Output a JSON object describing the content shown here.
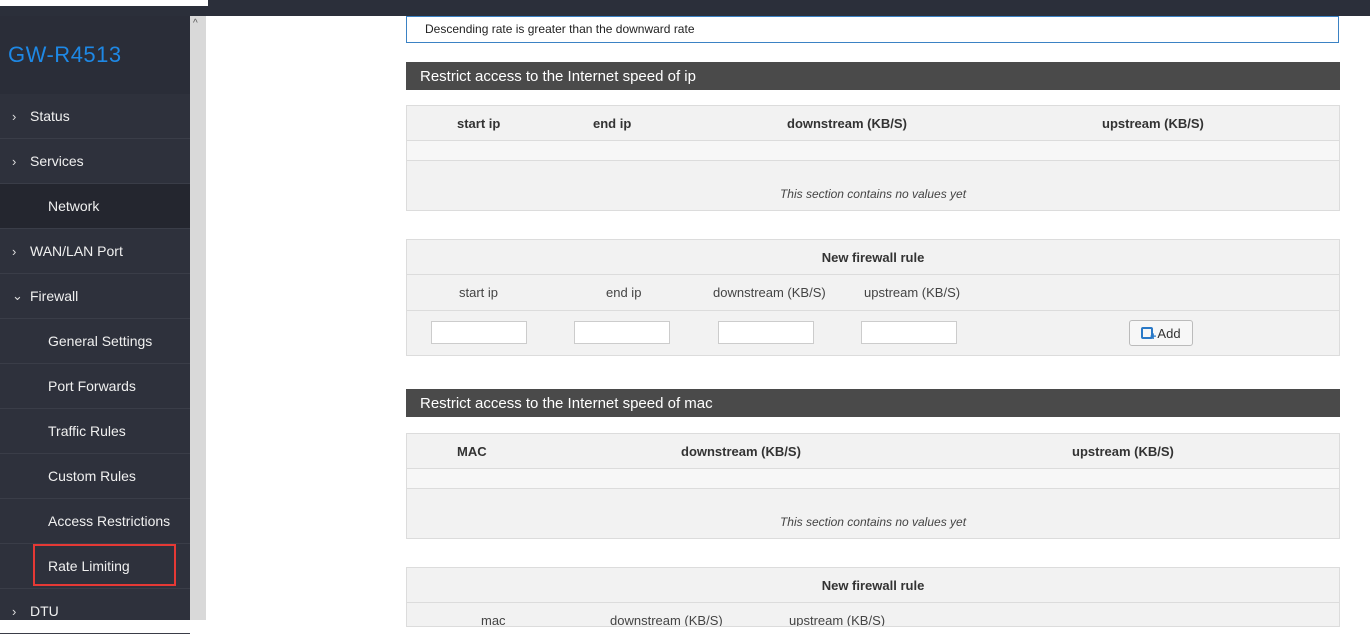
{
  "sidebar": {
    "brand": "GW-R4513",
    "items": [
      {
        "label": "Status",
        "chevron": ">"
      },
      {
        "label": "Services",
        "chevron": ">"
      },
      {
        "label": "Network",
        "chevron": ""
      },
      {
        "label": "WAN/LAN Port",
        "chevron": ">"
      },
      {
        "label": "Firewall",
        "chevron": "v"
      },
      {
        "label": "General Settings"
      },
      {
        "label": "Port Forwards"
      },
      {
        "label": "Traffic Rules"
      },
      {
        "label": "Custom Rules"
      },
      {
        "label": "Access Restrictions"
      },
      {
        "label": "Rate Limiting"
      },
      {
        "label": "DTU",
        "chevron": ">"
      }
    ]
  },
  "notice": "Descending rate is greater than the downward rate",
  "ip_section": {
    "title": "Restrict access to the Internet speed of ip",
    "headers": [
      "start ip",
      "end ip",
      "downstream (KB/S)",
      "upstream (KB/S)"
    ],
    "empty": "This section contains no values yet",
    "new_rule_title": "New firewall rule",
    "labels": [
      "start ip",
      "end ip",
      "downstream (KB/S)",
      "upstream (KB/S)"
    ],
    "add_label": "Add"
  },
  "mac_section": {
    "title": "Restrict access to the Internet speed of mac",
    "headers": [
      "MAC",
      "downstream (KB/S)",
      "upstream (KB/S)"
    ],
    "empty": "This section contains no values yet",
    "new_rule_title": "New firewall rule",
    "labels": [
      "mac",
      "downstream (KB/S)",
      "upstream (KB/S)"
    ]
  },
  "colors": {
    "accent": "#1e88e5",
    "sidebar": "#2e313c",
    "highlight": "#e53935"
  }
}
